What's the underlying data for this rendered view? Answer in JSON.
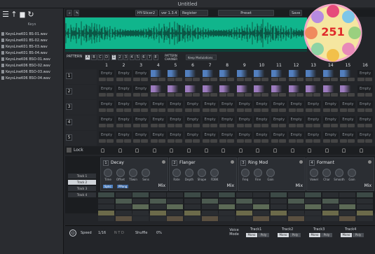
{
  "window_title": "Untitled",
  "sidebar": {
    "label": "Keys",
    "files": [
      "KeysLineK01 BS-01.wav",
      "KeysLineK01 BS-02.wav",
      "KeysLineK01 BS-03.wav",
      "KeysLineK01 BS-04.wav",
      "KeysLineK06 BSO-01.wav",
      "KeysLineK06 BSO-02.wav",
      "KeysLineK06 BSO-03.wav",
      "KeysLineK06 BSO-04.wav"
    ]
  },
  "toolbar": {
    "product": "HY-Slicer2",
    "version": "ver 1.3.4",
    "register": "Register",
    "preset": "Preset",
    "save": "Save"
  },
  "pattern": {
    "label": "PATTERN",
    "slots": [
      "A",
      "B",
      "C",
      "D"
    ],
    "nums": [
      "1",
      "2",
      "3",
      "4",
      "5",
      "6",
      "7",
      "8"
    ],
    "chain": "PATTERN CHAINER",
    "sync": "Keep Modulations"
  },
  "steps": [
    "1",
    "2",
    "3",
    "4",
    "5",
    "6",
    "7",
    "8",
    "9",
    "10",
    "11",
    "12",
    "13",
    "14",
    "15",
    "16"
  ],
  "tracks": [
    "1",
    "2",
    "3",
    "4",
    "5"
  ],
  "empty_label": "Empty",
  "lock_label": "Lock",
  "fx": [
    {
      "num": "1",
      "name": "Decay",
      "knobs": [
        "Time",
        "Offset",
        "TSwin",
        "Sens"
      ],
      "mix": "Mix",
      "extra": [
        "Sync",
        "PPang"
      ]
    },
    {
      "num": "2",
      "name": "Flanger",
      "knobs": [
        "Rate",
        "Depth",
        "Shape",
        "FDBK"
      ],
      "mix": "Mix"
    },
    {
      "num": "3",
      "name": "Ring Mod",
      "knobs": [
        "Freq",
        "Fine",
        "Gain"
      ],
      "mix": "Mix"
    },
    {
      "num": "4",
      "name": "Formant",
      "knobs": [
        "Vowel",
        "Char",
        "Smooth",
        "Gain"
      ],
      "mix": "Mix"
    }
  ],
  "track_btns": [
    "Track 1",
    "Track 2",
    "Track 3",
    "Track 4"
  ],
  "bottom": {
    "speed": "Speed",
    "speed_val": "1/16",
    "shuffle": "Shuffle",
    "shuffle_val": "0%",
    "voice": "Voice Mode",
    "tracks": [
      "Track1",
      "Track2",
      "Track3",
      "Track4"
    ],
    "modes": [
      "Mono",
      "Poly"
    ]
  },
  "colors": {
    "wave": "#10b58c",
    "accent_blue": "#4e8dd6",
    "accent_purple": "#b18ad8",
    "accent_yellow": "#d8c46a"
  }
}
